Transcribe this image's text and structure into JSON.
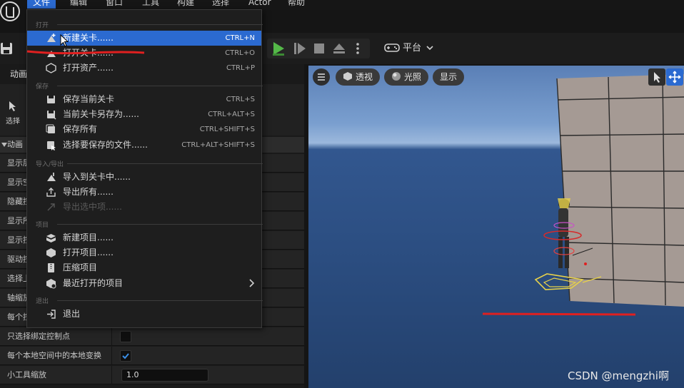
{
  "menubar": {
    "items": [
      {
        "label": "文件",
        "active": true
      },
      {
        "label": "编辑"
      },
      {
        "label": "窗口"
      },
      {
        "label": "工具"
      },
      {
        "label": "构建"
      },
      {
        "label": "选择"
      },
      {
        "label": "Actor"
      },
      {
        "label": "帮助"
      }
    ]
  },
  "toolbar": {
    "platform_label": "平台"
  },
  "left_panel": {
    "tab_label": "动画",
    "tool_label": "选择",
    "section_header": "动画",
    "rows": [
      {
        "label": "显示层"
      },
      {
        "label": "显示空"
      },
      {
        "label": "隐藏控"
      },
      {
        "label": "显示所"
      },
      {
        "label": "显示控"
      },
      {
        "label": "驱动控"
      },
      {
        "label": "选择上"
      },
      {
        "label": "轴缩放"
      },
      {
        "label": "每个控"
      },
      {
        "label": "只选择绑定控制点",
        "checkbox": false
      },
      {
        "label": "每个本地空间中的本地变换",
        "checkbox": true
      },
      {
        "label": "小工具缩放",
        "value": "1.0"
      }
    ]
  },
  "viewport": {
    "perspective_label": "透视",
    "lighting_label": "光照",
    "show_label": "显示"
  },
  "file_menu": {
    "sections": [
      {
        "title": "打开",
        "items": [
          {
            "label": "新建关卡......",
            "shortcut": "CTRL+N",
            "icon": "new-level-icon",
            "highlight": true
          },
          {
            "label": "打开关卡......",
            "shortcut": "CTRL+O",
            "icon": "open-level-icon"
          },
          {
            "label": "打开资产......",
            "shortcut": "CTRL+P",
            "icon": "open-asset-icon"
          }
        ]
      },
      {
        "title": "保存",
        "items": [
          {
            "label": "保存当前关卡",
            "shortcut": "CTRL+S",
            "icon": "save-icon"
          },
          {
            "label": "当前关卡另存为......",
            "shortcut": "CTRL+ALT+S",
            "icon": "save-as-icon"
          },
          {
            "label": "保存所有",
            "shortcut": "CTRL+SHIFT+S",
            "icon": "save-all-icon"
          },
          {
            "label": "选择要保存的文件......",
            "shortcut": "CTRL+ALT+SHIFT+S",
            "icon": "choose-files-icon"
          }
        ]
      },
      {
        "title": "导入/导出",
        "items": [
          {
            "label": "导入到关卡中......",
            "shortcut": "",
            "icon": "import-icon"
          },
          {
            "label": "导出所有......",
            "shortcut": "",
            "icon": "export-icon"
          },
          {
            "label": "导出选中项......",
            "shortcut": "",
            "icon": "export-selected-icon",
            "disabled": true
          }
        ]
      },
      {
        "title": "项目",
        "items": [
          {
            "label": "新建项目......",
            "shortcut": "",
            "icon": "new-project-icon"
          },
          {
            "label": "打开项目......",
            "shortcut": "",
            "icon": "open-project-icon"
          },
          {
            "label": "压缩项目",
            "shortcut": "",
            "icon": "zip-project-icon"
          },
          {
            "label": "最近打开的项目",
            "shortcut": "",
            "icon": "recent-projects-icon",
            "submenu": true
          }
        ]
      },
      {
        "title": "退出",
        "items": [
          {
            "label": "退出",
            "shortcut": "",
            "icon": "exit-icon"
          }
        ]
      }
    ]
  },
  "watermark": "CSDN @mengzhi啊",
  "colors": {
    "highlight": "#2b6ad0",
    "annotation_red": "#e02020",
    "play_green": "#54b848",
    "checkbox_blue": "#3a8ee6"
  }
}
